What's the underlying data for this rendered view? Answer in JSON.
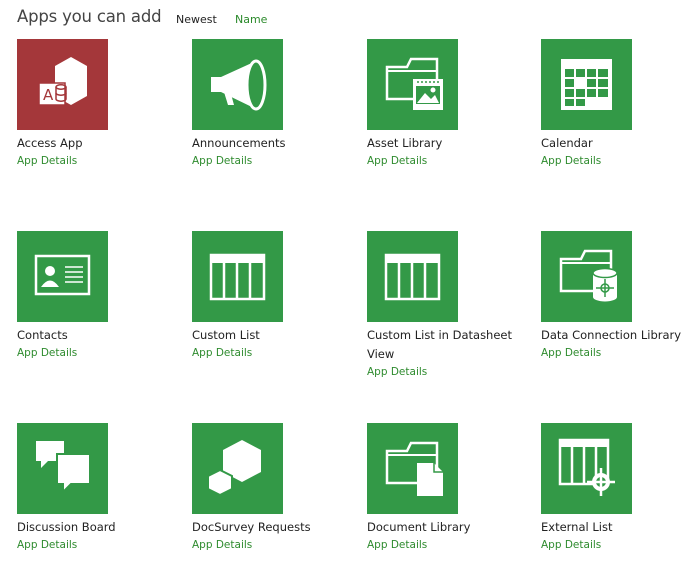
{
  "header": {
    "title": "Apps you can add",
    "sort_newest": "Newest",
    "sort_name": "Name"
  },
  "colors": {
    "tile_green": "#339947",
    "access_red": "#a4373a",
    "link_green": "#2e8b2e"
  },
  "apps": [
    {
      "title": "Access App",
      "details": "App Details",
      "icon": "access-app-icon"
    },
    {
      "title": "Announcements",
      "details": "App Details",
      "icon": "megaphone-icon"
    },
    {
      "title": "Asset Library",
      "details": "App Details",
      "icon": "folder-picture-icon"
    },
    {
      "title": "Calendar",
      "details": "App Details",
      "icon": "calendar-icon"
    },
    {
      "title": "Contacts",
      "details": "App Details",
      "icon": "contact-card-icon"
    },
    {
      "title": "Custom List",
      "details": "App Details",
      "icon": "list-grid-icon"
    },
    {
      "title": "Custom List in Datasheet View",
      "details": "App Details",
      "icon": "datasheet-grid-icon"
    },
    {
      "title": "Data Connection Library",
      "details": "App Details",
      "icon": "folder-database-icon"
    },
    {
      "title": "Discussion Board",
      "details": "App Details",
      "icon": "speech-bubbles-icon"
    },
    {
      "title": "DocSurvey Requests",
      "details": "App Details",
      "icon": "hexagons-icon"
    },
    {
      "title": "Document Library",
      "details": "App Details",
      "icon": "folder-document-icon"
    },
    {
      "title": "External List",
      "details": "App Details",
      "icon": "external-list-icon"
    }
  ]
}
